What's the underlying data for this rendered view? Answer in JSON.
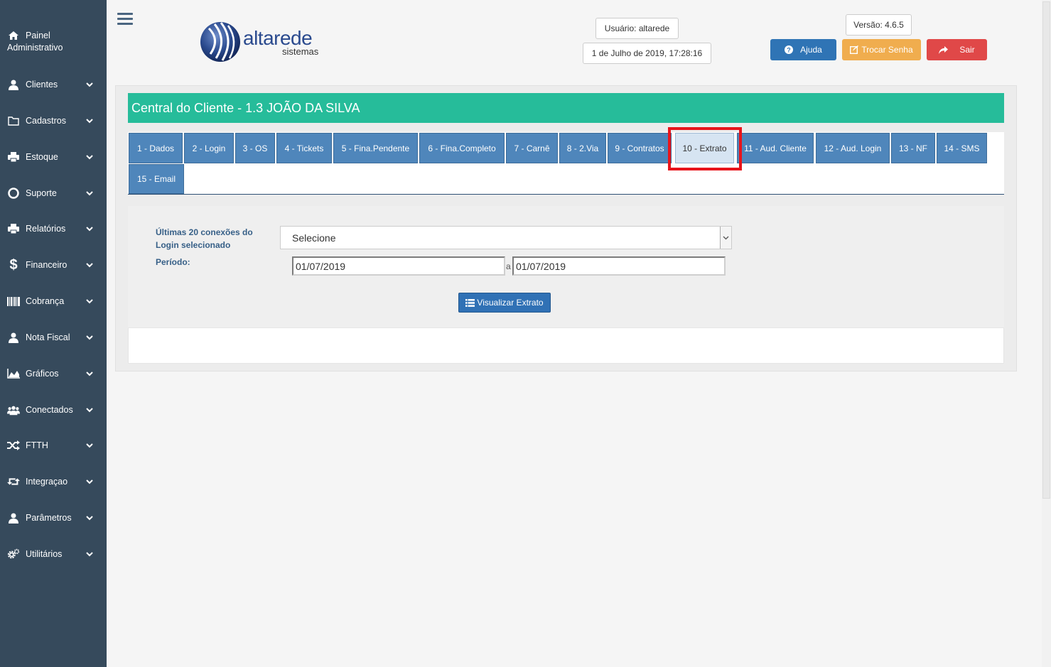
{
  "sidebar": {
    "items": [
      {
        "label_line1": "Painel",
        "label_line2": "Administrativo",
        "icon": "home-icon"
      },
      {
        "label": "Clientes",
        "icon": "user-icon"
      },
      {
        "label": "Cadastros",
        "icon": "folder-icon"
      },
      {
        "label": "Estoque",
        "icon": "print-icon"
      },
      {
        "label": "Suporte",
        "icon": "life-ring-icon"
      },
      {
        "label": "Relatórios",
        "icon": "print-icon"
      },
      {
        "label": "Financeiro",
        "icon": "dollar-icon"
      },
      {
        "label": "Cobrança",
        "icon": "barcode-icon"
      },
      {
        "label": "Nota Fiscal",
        "icon": "user-icon"
      },
      {
        "label": "Gráficos",
        "icon": "area-chart-icon"
      },
      {
        "label": "Conectados",
        "icon": "users-icon"
      },
      {
        "label": "FTTH",
        "icon": "random-icon"
      },
      {
        "label": "Integraçao",
        "icon": "retweet-icon"
      },
      {
        "label": "Parâmetros",
        "icon": "user-icon"
      },
      {
        "label": "Utilitários",
        "icon": "cogs-icon"
      }
    ]
  },
  "header": {
    "logo_main": "altarede",
    "logo_sub": "sistemas",
    "user": "Usuário: altarede",
    "datetime": "1 de Julho de 2019, 17:28:16",
    "version": "Versão: 4.6.5",
    "help_label": "Ajuda",
    "change_password_label": "Trocar Senha",
    "logout_label": "Sair"
  },
  "colors": {
    "sidebar": "#364a5c",
    "title_bar": "#26bc9a",
    "tab": "#4f86bb",
    "help": "#2f74b5",
    "change_password": "#f0ad4e",
    "logout": "#e04848",
    "highlight": "#e8141b"
  },
  "main": {
    "title": "Central do Cliente - 1.3 JOÃO DA SILVA",
    "tabs": [
      {
        "label": "1 - Dados"
      },
      {
        "label": "2 - Login"
      },
      {
        "label": "3 - OS"
      },
      {
        "label": "4 - Tickets"
      },
      {
        "label": "5 - Fina.Pendente"
      },
      {
        "label": "6 - Fina.Completo"
      },
      {
        "label": "7 - Carnê"
      },
      {
        "label": "8 - 2.Via"
      },
      {
        "label": "9 - Contratos"
      },
      {
        "label": "10 - Extrato",
        "active": true
      },
      {
        "label": "11 - Aud. Cliente"
      },
      {
        "label": "12 - Aud. Login"
      },
      {
        "label": "13 - NF"
      },
      {
        "label": "14 - SMS"
      },
      {
        "label": "15 - Email"
      }
    ],
    "form": {
      "connections_label_line1": "Últimas 20 conexões do",
      "connections_label_line2": "Login selecionado",
      "connections_selected": "Selecione",
      "period_label": "Período:",
      "date_from": "01/07/2019",
      "date_separator": "a",
      "date_to": "01/07/2019",
      "view_button": "Visualizar Extrato"
    }
  }
}
